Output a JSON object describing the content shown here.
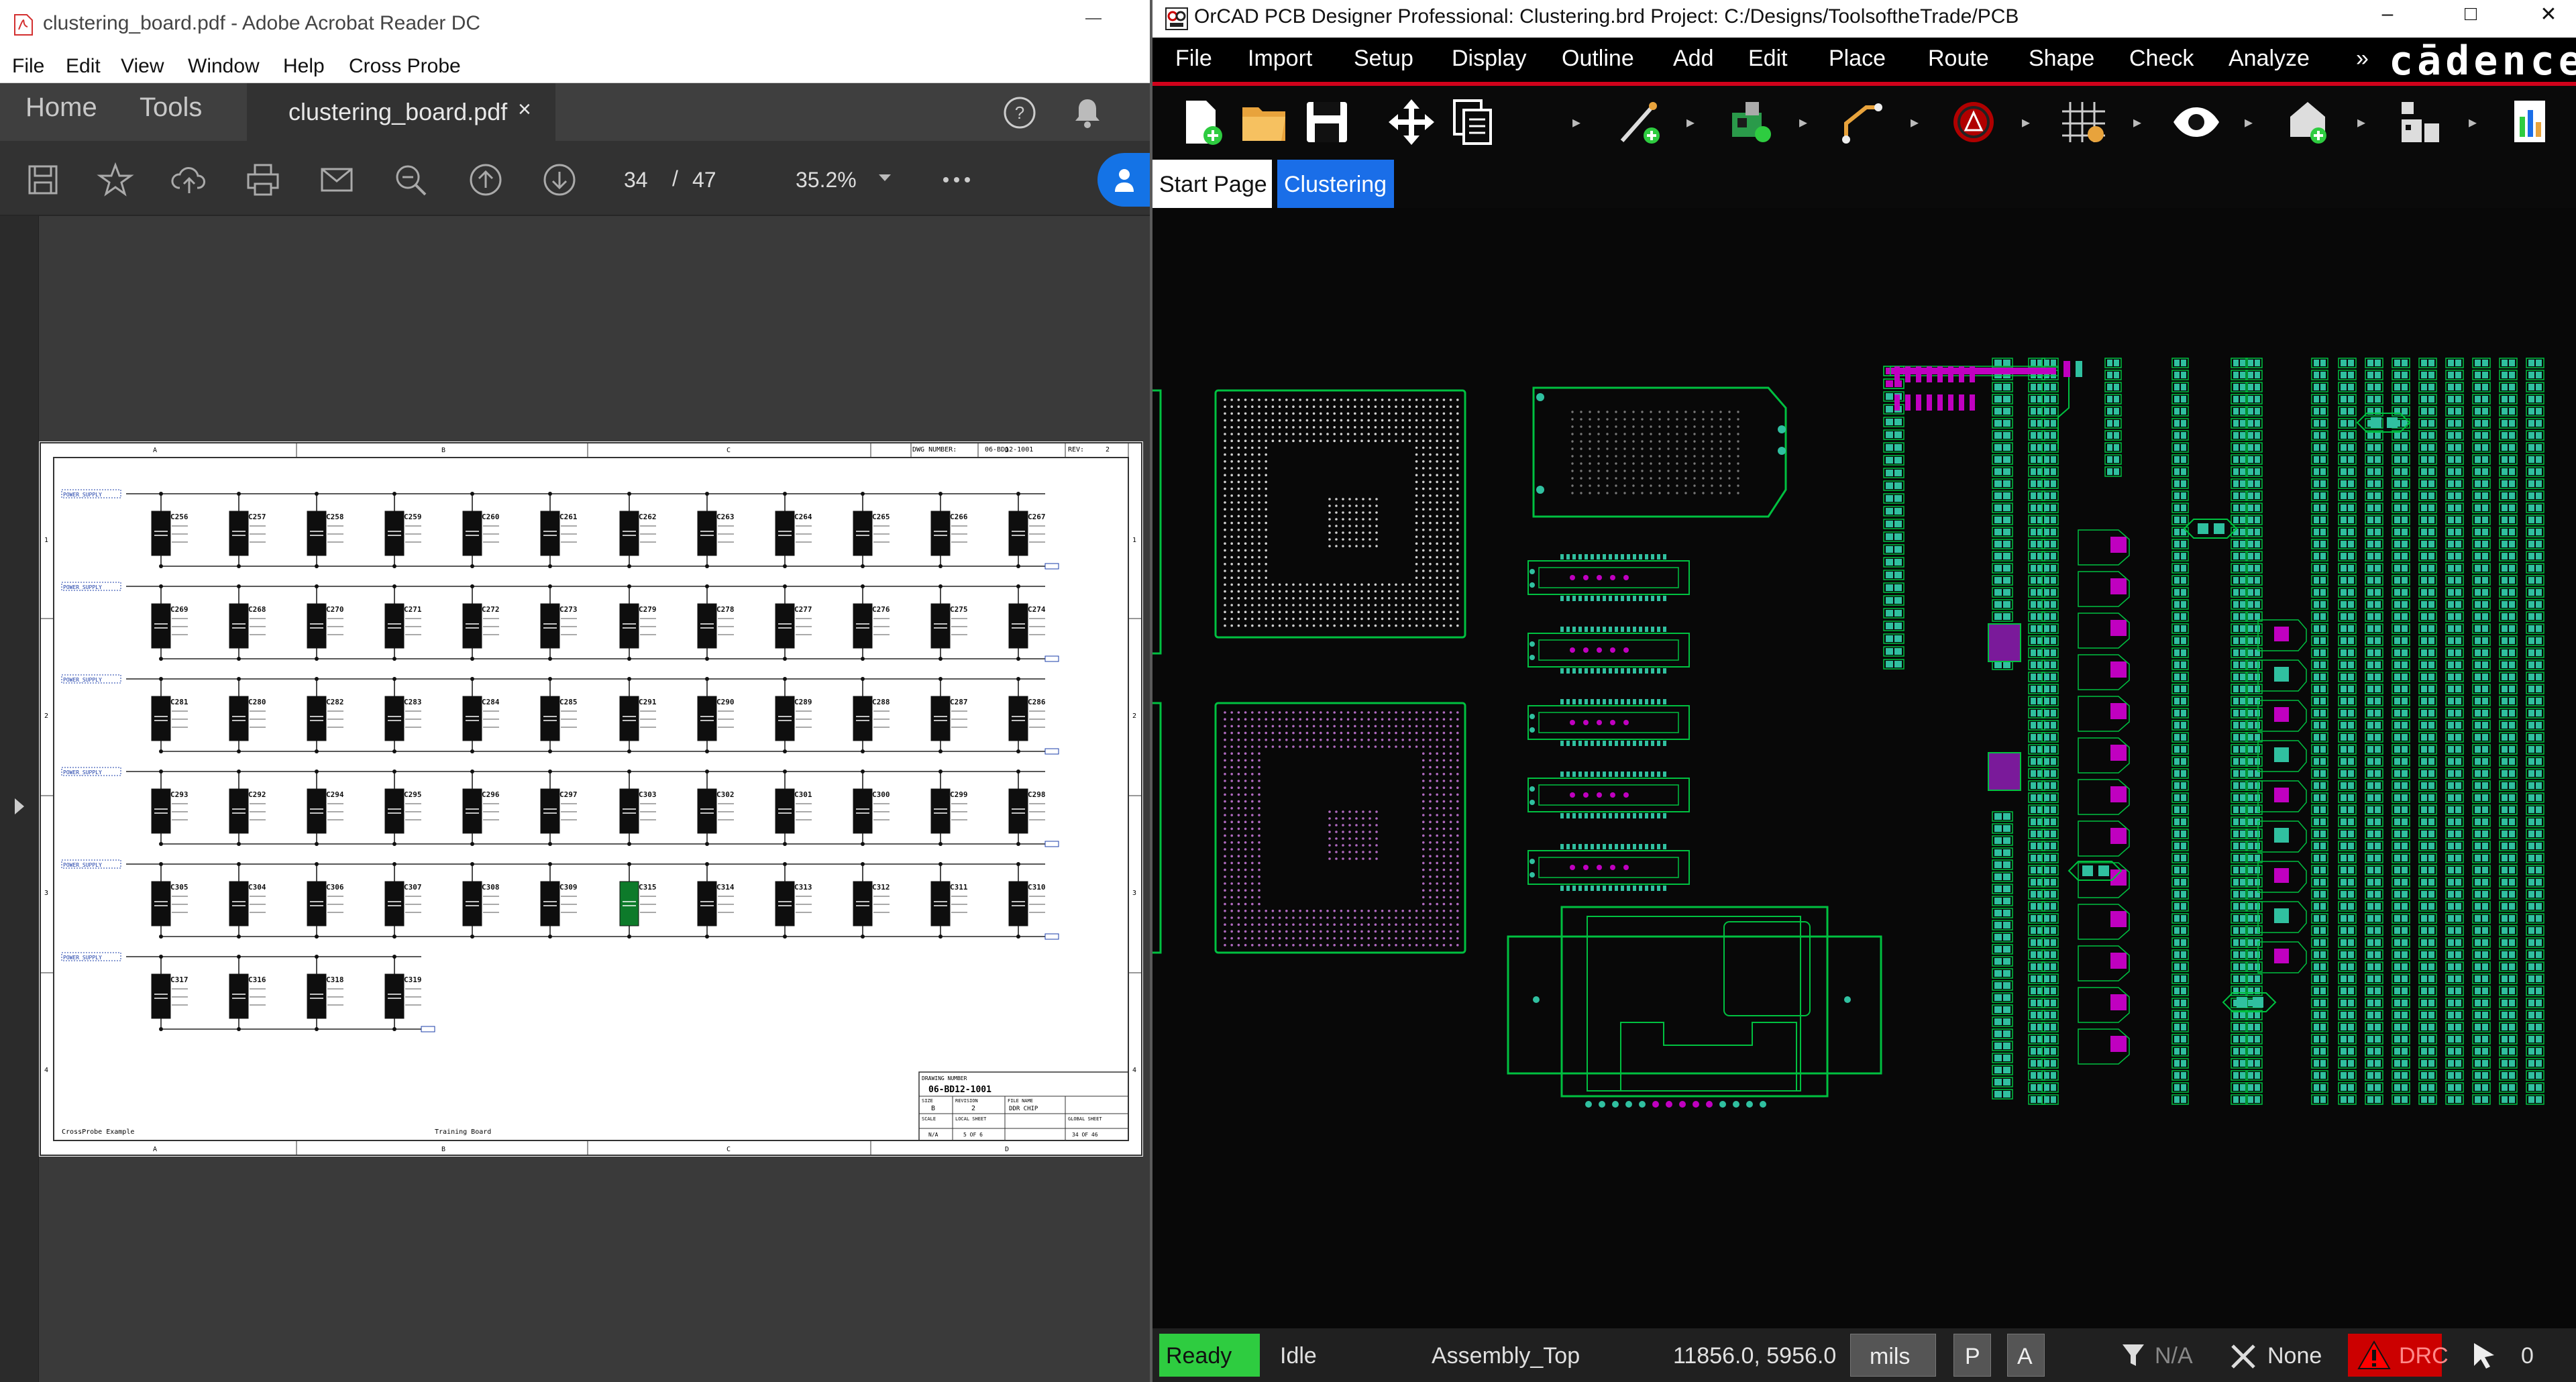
{
  "acrobat": {
    "window_title": "clustering_board.pdf - Adobe Acrobat Reader DC",
    "menu": [
      "File",
      "Edit",
      "View",
      "Window",
      "Help",
      "Cross Probe"
    ],
    "tabs": {
      "home": "Home",
      "tools": "Tools",
      "document": "clustering_board.pdf",
      "close": "×"
    },
    "toolbar": {
      "page_current": "34",
      "page_separator": "/",
      "page_total": "47",
      "zoom": "35.2%"
    },
    "icons": [
      "save-icon",
      "star-icon",
      "cloud-upload-icon",
      "print-icon",
      "mail-icon",
      "zoom-out-icon",
      "page-up-icon",
      "page-down-icon",
      "more-icon",
      "share-icon",
      "help-icon",
      "bell-icon"
    ],
    "schematic": {
      "header_dwg_label": "DWG NUMBER:",
      "header_dwg_value": "06-BD12-1001",
      "header_rev_label": "REV:",
      "header_rev_value": "2",
      "columns": [
        "A",
        "B",
        "C",
        "D"
      ],
      "rows": [
        "1",
        "2",
        "3",
        "4"
      ],
      "rails": [
        "POWER_SUPPLY",
        "POWER_SUPPLY",
        "POWER_SUPPLY",
        "POWER_SUPPLY",
        "POWER_SUPPLY",
        "POWER_SUPPLY"
      ],
      "component_rows": [
        [
          "C256",
          "C257",
          "C258",
          "C259",
          "C260",
          "C261",
          "C262",
          "C263",
          "C264",
          "C265",
          "C266",
          "C267"
        ],
        [
          "C269",
          "C268",
          "C270",
          "C271",
          "C272",
          "C273",
          "C279",
          "C278",
          "C277",
          "C276",
          "C275",
          "C274"
        ],
        [
          "C281",
          "C280",
          "C282",
          "C283",
          "C284",
          "C285",
          "C291",
          "C290",
          "C289",
          "C288",
          "C287",
          "C286"
        ],
        [
          "C293",
          "C292",
          "C294",
          "C295",
          "C296",
          "C297",
          "C303",
          "C302",
          "C301",
          "C300",
          "C299",
          "C298"
        ],
        [
          "C305",
          "C304",
          "C306",
          "C307",
          "C308",
          "C309",
          "C315",
          "C314",
          "C313",
          "C312",
          "C311",
          "C310"
        ],
        [
          "C317",
          "C316",
          "C318",
          "C319"
        ]
      ],
      "footer_left": "CrossProbe Example",
      "footer_mid": "Training Board",
      "title_block": {
        "drawing_number_label": "DRAWING NUMBER",
        "drawing_number": "06-BD12-1001",
        "size_label": "SIZE",
        "size": "B",
        "revision_label": "REVISION",
        "revision": "2",
        "file_name_label": "FILE NAME",
        "file_name": "DDR CHIP",
        "scale_label": "SCALE",
        "scale": "N/A",
        "local_sheet_label": "LOCAL SHEET",
        "local_sheet": "5 OF 6",
        "global_sheet_label": "GLOBAL SHEET",
        "global_sheet": "34 OF 46"
      }
    }
  },
  "orcad": {
    "window_title": "OrCAD PCB Designer Professional: Clustering.brd  Project: C:/Designs/ToolsoftheTrade/PCB",
    "window_buttons": {
      "minimize": "–",
      "maximize": "□",
      "close": "✕"
    },
    "menu": [
      "File",
      "Import",
      "Setup",
      "Display",
      "Outline",
      "Add",
      "Edit",
      "Place",
      "Route",
      "Shape",
      "Check",
      "Analyze"
    ],
    "menu_overflow": "»",
    "brand": "cādence",
    "tabs": [
      "Start Page",
      "Clustering"
    ],
    "toolbar_icons": [
      "new-file-icon",
      "open-folder-icon",
      "save-icon",
      "move-icon",
      "copy-icon",
      "add-connect-icon",
      "place-component-icon",
      "route-icon",
      "drc-check-icon",
      "grid-icon",
      "visibility-icon",
      "shape-add-icon",
      "placement-icon",
      "report-icon"
    ],
    "status": {
      "ready": "Ready",
      "idle": "Idle",
      "layer": "Assembly_Top",
      "coords": "11856.0, 5956.0",
      "units": "mils",
      "p": "P",
      "a": "A",
      "filter": "N/A",
      "snap": "None",
      "drc": "DRC",
      "count": "0"
    },
    "colors": {
      "board_green": "#00c040",
      "pad_teal": "#30c0a0",
      "pad_magenta": "#c000c0",
      "ready": "#2ecc40",
      "accent_blue": "#1a6ee8",
      "drc_red": "#cc0000"
    }
  }
}
